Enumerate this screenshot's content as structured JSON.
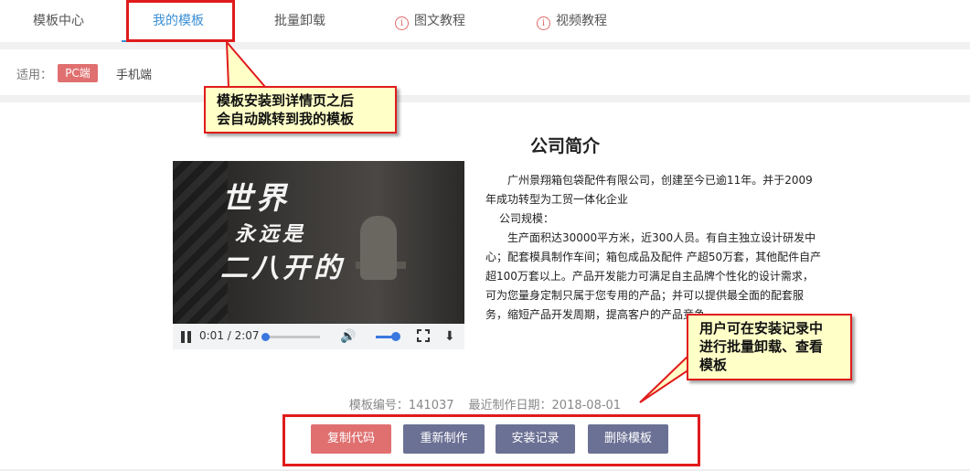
{
  "tabs": [
    {
      "label": "模板中心"
    },
    {
      "label": "我的模板"
    },
    {
      "label": "批量卸载"
    },
    {
      "label": "图文教程"
    },
    {
      "label": "视频教程"
    }
  ],
  "filter": {
    "label": "适用：",
    "pc": "PC端",
    "mobile": "手机端"
  },
  "video": {
    "title_line1": "世界",
    "title_line2": "永远是",
    "title_line3": "二八开的",
    "time": "0:01 / 2:07",
    "progress": 0.008
  },
  "article": {
    "title": "公司简介",
    "p1": "广州景翔箱包袋配件有限公司，创建至今已逾11年。并于2009年成功转型为工贸一体化企业",
    "p2": "公司规模：",
    "p3": "生产面积达30000平方米，近300人员。有自主独立设计研发中心；配套模具制作车间；箱包成品及配件 产超50万套，其他配件自产超100万套以上。产品开发能力可满足自主品牌个性化的设计需求，可为您量身定制只属于您专用的产品；并可以提供最全面的配套服务，缩短产品开发周期，提高客户的产品竞争"
  },
  "meta": {
    "id": "模板编号：141037",
    "date": "最近制作日期：2018-08-01"
  },
  "actions": {
    "copy": "复制代码",
    "remake": "重新制作",
    "log": "安装记录",
    "delete": "删除模板"
  },
  "annotations": {
    "callout1_line1": "模板安装到详情页之后",
    "callout1_line2": "会自动跳转到我的模板",
    "callout2_line1": "用户可在安装记录中",
    "callout2_line2": "进行批量卸载、查看",
    "callout2_line3": "模板"
  },
  "colors": {
    "accent_blue": "#3a8fd6",
    "pink": "#e07070",
    "slate": "#6b7194",
    "highlight_red": "#e01b1b",
    "callout_bg": "#ffffc8"
  },
  "icons": [
    "info-icon",
    "pause-icon",
    "volume-icon",
    "fullscreen-icon",
    "download-icon"
  ]
}
